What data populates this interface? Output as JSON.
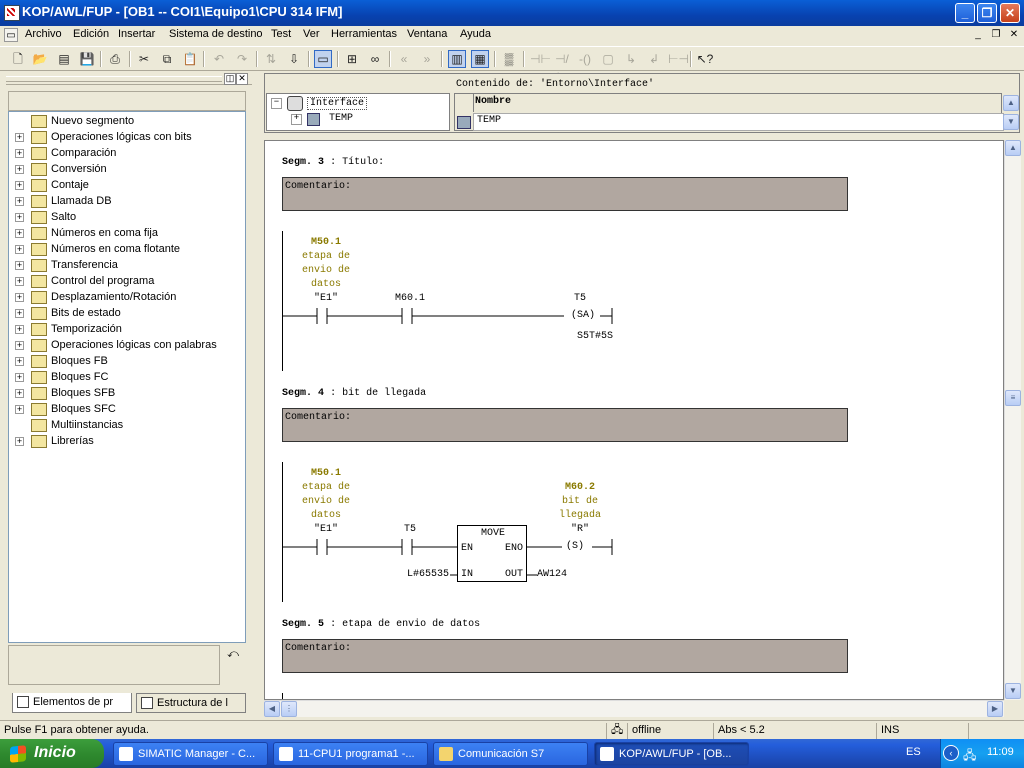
{
  "window": {
    "title": "KOP/AWL/FUP  - [OB1 -- COI1\\Equipo1\\CPU 314 IFM]"
  },
  "menu": [
    "Archivo",
    "Edición",
    "Insertar",
    "Sistema de destino",
    "Test",
    "Ver",
    "Herramientas",
    "Ventana",
    "Ayuda"
  ],
  "toolbar_icons": [
    "new-icon",
    "open-icon",
    "accessible-nodes-icon",
    "save-icon",
    "print-icon",
    "cut-icon",
    "copy-icon",
    "paste-icon",
    "undo-icon",
    "redo-icon",
    "load-icon",
    "download-icon",
    "network-icon",
    "overview-icon",
    "monitor-icon",
    "previous-error-icon",
    "next-error-icon",
    "program-elements-icon",
    "details-icon",
    "new-network-icon",
    "contact-no-icon",
    "contact-nc-icon",
    "coil-icon",
    "empty-box-icon",
    "open-branch-icon",
    "close-branch-icon",
    "connection-icon",
    "help-icon"
  ],
  "catalog": {
    "items": [
      {
        "label": "Nuevo segmento",
        "icon": "new-network-icon",
        "expandable": false
      },
      {
        "label": "Operaciones lógicas con bits",
        "icon": "folder-icon",
        "expandable": true
      },
      {
        "label": "Comparación",
        "icon": "folder-icon",
        "expandable": true
      },
      {
        "label": "Conversión",
        "icon": "folder-icon",
        "expandable": true
      },
      {
        "label": "Contaje",
        "icon": "folder-icon",
        "expandable": true
      },
      {
        "label": "Llamada DB",
        "icon": "db-icon",
        "expandable": true
      },
      {
        "label": "Salto",
        "icon": "folder-icon",
        "expandable": true
      },
      {
        "label": "Números en coma fija",
        "icon": "folder-icon",
        "expandable": true
      },
      {
        "label": "Números en coma flotante",
        "icon": "folder-icon",
        "expandable": true
      },
      {
        "label": "Transferencia",
        "icon": "folder-icon",
        "expandable": true
      },
      {
        "label": "Control del programa",
        "icon": "folder-icon",
        "expandable": true
      },
      {
        "label": "Desplazamiento/Rotación",
        "icon": "folder-icon",
        "expandable": true
      },
      {
        "label": "Bits de estado",
        "icon": "folder-icon",
        "expandable": true
      },
      {
        "label": "Temporización",
        "icon": "clock-icon",
        "expandable": true
      },
      {
        "label": "Operaciones lógicas con palabras",
        "icon": "folder-icon",
        "expandable": true
      },
      {
        "label": "Bloques FB",
        "icon": "folder-icon",
        "expandable": true
      },
      {
        "label": "Bloques FC",
        "icon": "folder-icon",
        "expandable": true
      },
      {
        "label": "Bloques SFB",
        "icon": "folder-icon",
        "expandable": true
      },
      {
        "label": "Bloques SFC",
        "icon": "folder-icon",
        "expandable": true
      },
      {
        "label": "Multiinstancias",
        "icon": "multiinstance-icon",
        "expandable": false
      },
      {
        "label": "Librerías",
        "icon": "library-icon",
        "expandable": true
      }
    ],
    "tabs": [
      "Elementos de pr",
      "Estructura de l"
    ]
  },
  "interface": {
    "tree_root": "Interface",
    "tree_child": "TEMP",
    "content_label": "Contenido de: 'Entorno\\Interface'",
    "column": "Nombre",
    "row": "TEMP"
  },
  "networks": {
    "n3": {
      "seg_label": "Segm.",
      "number": "3",
      "sep": ":",
      "title": "Título:",
      "comment": "Comentario:",
      "contact1": {
        "addr": "M50.1",
        "desc": [
          "etapa de",
          "envio de",
          "datos"
        ],
        "sym": "\"E1\""
      },
      "contact2": {
        "addr": "M60.1"
      },
      "coil": {
        "addr": "T5",
        "label": "(SA)",
        "value": "S5T#5S"
      }
    },
    "n4": {
      "seg_label": "Segm.",
      "number": "4",
      "sep": ":",
      "title": "bit de llegada",
      "comment": "Comentario:",
      "contact1": {
        "addr": "M50.1",
        "desc": [
          "etapa de",
          "envio de",
          "datos"
        ],
        "sym": "\"E1\""
      },
      "contact2": {
        "addr": "T5"
      },
      "box": {
        "name": "MOVE",
        "en": "EN",
        "eno": "ENO",
        "in": "IN",
        "out": "OUT",
        "in_val": "L#65535",
        "out_val": "AW124"
      },
      "coil": {
        "addr": "M60.2",
        "desc": [
          "bit de",
          "llegada"
        ],
        "sym": "\"R\"",
        "label": "(S)"
      }
    },
    "n5": {
      "seg_label": "Segm.",
      "number": "5",
      "sep": ":",
      "title": "etapa de envio de datos",
      "comment": "Comentario:"
    }
  },
  "status": {
    "help": "Pulse F1 para obtener ayuda.",
    "mode": "offline",
    "abs": "Abs < 5.2",
    "ins": "INS"
  },
  "taskbar": {
    "start": "Inicio",
    "tasks": [
      "SIMATIC Manager - C...",
      "11-CPU1 programa1 -...",
      "Comunicación S7",
      "KOP/AWL/FUP - [OB..."
    ],
    "lang": "ES",
    "time": "11:09"
  }
}
